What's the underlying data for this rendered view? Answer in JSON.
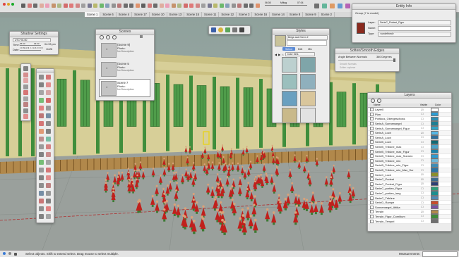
{
  "scene_tabs": [
    "Scene 1",
    "Scene 6",
    "Scene 4",
    "Scene 17",
    "Scene 10",
    "Scene 13",
    "Scene 15",
    "Scene 11",
    "Scene 12",
    "Scene 3",
    "Scene 16",
    "Scene 14",
    "Scene 8",
    "Scene 9",
    "Scene 2"
  ],
  "timeline": {
    "start": "06:08",
    "mid": "Mittag",
    "end": "07:04"
  },
  "shadow": {
    "title": "Shadow Settings",
    "tz": "UTC+01:00",
    "time_label": "Time:",
    "time_start": "06:43",
    "time_end": "04:33",
    "time_value": "04:33 pm",
    "date_label": "Date:",
    "months": "J F M A M J J A S O N D",
    "date_value": "11/26"
  },
  "scenes": {
    "title": "Scenes",
    "items": [
      {
        "name": "(Scene 9)",
        "photo": "Photo:",
        "desc": "No Description"
      },
      {
        "name": "(Scene 5",
        "photo": "Photo:",
        "desc": "No Description"
      },
      {
        "name": "Scene 7",
        "photo": "Photo:",
        "desc": "No Description"
      }
    ]
  },
  "styles": {
    "title": "Styles",
    "style_name": "Beige and Green 2",
    "tabs": [
      "Select",
      "Edit",
      "Mix"
    ],
    "dropdown": "Color Sets"
  },
  "soften": {
    "title": "Soften/Smooth Edges",
    "angle_label": "Angle Between Normals",
    "angle_value": "360 Degrees",
    "opt1": "Smooth Normals",
    "opt2": "Soften coplanar"
  },
  "entity": {
    "title": "Entity Info",
    "subtitle": "Group (7 in model)",
    "layer_label": "Layer:",
    "layer_value": "SerieC_Podest_Figur",
    "name_label": "Name:",
    "name_value": "",
    "type_label": "Type:",
    "type_value": "<undefined>"
  },
  "layers": {
    "title": "Layers",
    "col_name": "Name",
    "col_visible": "Visible",
    "col_color": "Color",
    "rows": [
      {
        "name": "Layer0",
        "visible": true,
        "color": "#ffffff"
      },
      {
        "name": "Plan",
        "visible": false,
        "color": "#2c9fd6"
      },
      {
        "name": "Portikus_Obergeschoss",
        "visible": false,
        "color": "#2b8fb3"
      },
      {
        "name": "SerieA_Sonnensegel",
        "visible": false,
        "color": "#1f7f93"
      },
      {
        "name": "SerieA_Sonnensegel_Figur",
        "visible": false,
        "color": "#31a5c6"
      },
      {
        "name": "SerieA_Loch",
        "visible": true,
        "color": "#55b8e6"
      },
      {
        "name": "SerieA_Loch",
        "visible": false,
        "color": "#2e6e9a"
      },
      {
        "name": "SerieB_Loch",
        "visible": false,
        "color": "#0f6a75"
      },
      {
        "name": "SerieB_Tribüne_max",
        "visible": false,
        "color": "#4aa3c8"
      },
      {
        "name": "SerieB_Tribüne_max_Figur",
        "visible": false,
        "color": "#1c82a8"
      },
      {
        "name": "SerieB_Tribüne_max_Sonnen",
        "visible": false,
        "color": "#2d9bd0"
      },
      {
        "name": "SerieB_Tribüne_min",
        "visible": false,
        "color": "#6cb9d9"
      },
      {
        "name": "SerieB_Tribüne_min_Figur",
        "visible": false,
        "color": "#3e8db6"
      },
      {
        "name": "SerieB_Tribüne_min_Max_Sor",
        "visible": false,
        "color": "#2a74a4"
      },
      {
        "name": "SerieC_Loch",
        "visible": true,
        "color": "#8b8f2a"
      },
      {
        "name": "SerieC_Podest",
        "visible": true,
        "color": "#3a6b8e"
      },
      {
        "name": "SerieC_Podest_Figur",
        "visible": true,
        "color": "#2d3f74"
      },
      {
        "name": "SerieC_portiee_Figur",
        "visible": false,
        "color": "#2f9d7a"
      },
      {
        "name": "SerieC_portiee_lang",
        "visible": false,
        "color": "#1c8f8f"
      },
      {
        "name": "SerieC_Tribüne",
        "visible": false,
        "color": "#4f8ab5"
      },
      {
        "name": "SerieD_Rampe",
        "visible": false,
        "color": "#c94b2b"
      },
      {
        "name": "Sonnensegel_Attika",
        "visible": false,
        "color": "#7a4fa3"
      },
      {
        "name": "Terrain",
        "visible": true,
        "color": "#b28a4a"
      },
      {
        "name": "Terrain_Figur_Comitium",
        "visible": false,
        "color": "#3f8b3a"
      },
      {
        "name": "Terrain_Tempel",
        "visible": false,
        "color": "#6d6d6d"
      }
    ]
  },
  "status": {
    "text": "Select objects. Shift to extend select. Drag mouse to select multiple.",
    "measurements_label": "Measurements"
  },
  "colors": {
    "building": "#d7cf98",
    "columns_green": "#3f8e3c",
    "railing": "#b5843d",
    "ground": "#9aa09c",
    "figures": "#c0201c"
  }
}
